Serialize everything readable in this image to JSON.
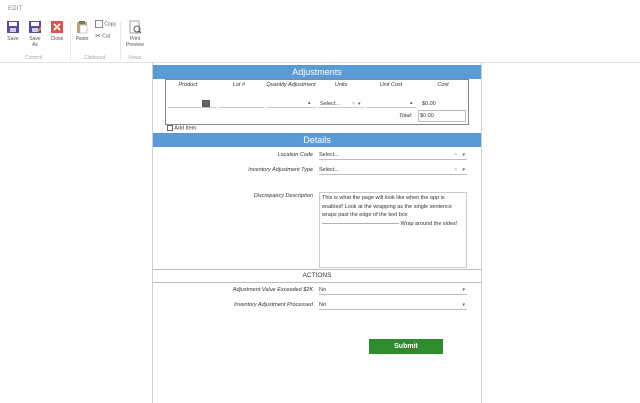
{
  "ribbon": {
    "tab": "EDIT",
    "buttons": {
      "save": "Save",
      "save_as": "Save As",
      "close": "Close",
      "paste": "Paste",
      "copy": "Copy",
      "cut": "Cut",
      "print_preview": "Print Preview"
    },
    "groups": {
      "commit": "Commit",
      "clipboard": "Clipboard",
      "views": "Views"
    }
  },
  "adjustments": {
    "title": "Adjustments",
    "columns": [
      "Product",
      "Lot #",
      "Quantity Adjustment",
      "Units",
      "Unit Cost",
      "Cost"
    ],
    "row": {
      "units": "Select...",
      "cost": "$0.00"
    },
    "total_label": "Total:",
    "total_value": "$0.00",
    "add_item": "Add Item"
  },
  "details": {
    "title": "Details",
    "location_code_label": "Location Code",
    "location_code_value": "Select...",
    "adjustment_type_label": "Inventory Adjustment Type",
    "adjustment_type_value": "Select...",
    "discrepancy_label": "Discrepancy Description",
    "discrepancy_text": "This is what the page will look like when the app is enabled! Look at the wrapping as the single sentence wraps past the edge of the text box —————————————— Wrap around the sides!"
  },
  "actions": {
    "title": "ACTIONS",
    "exceeded_label": "Adjustment Value Exceeded $2K",
    "exceeded_value": "No",
    "processed_label": "Inventory Adjustment Processed",
    "processed_value": "No",
    "submit": "Submit"
  },
  "icons": [
    "save-icon",
    "save-as-icon",
    "close-icon",
    "paste-icon",
    "copy-icon",
    "cut-icon",
    "print-preview-icon",
    "add-item-icon",
    "dropdown-arrow-icon",
    "clear-icon"
  ],
  "colors": {
    "header_bar": "#5b9bd5",
    "submit": "#2e8b2e",
    "close_red": "#d9534f",
    "save_purple": "#5b4a9b"
  }
}
